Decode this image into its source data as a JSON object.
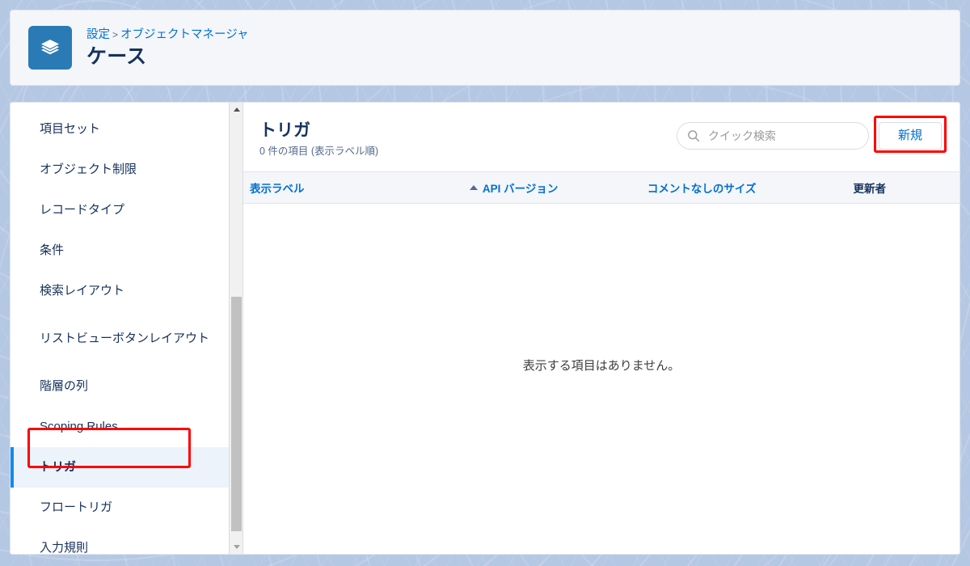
{
  "header": {
    "object_icon": "stacked-layers-icon",
    "breadcrumb": {
      "root": "設定",
      "separator": ">",
      "section": "オブジェクトマネージャ"
    },
    "page_title": "ケース"
  },
  "sidebar": {
    "items": [
      {
        "label": "項目セット",
        "selected": false
      },
      {
        "label": "オブジェクト制限",
        "selected": false
      },
      {
        "label": "レコードタイプ",
        "selected": false
      },
      {
        "label": "条件",
        "selected": false
      },
      {
        "label": "検索レイアウト",
        "selected": false
      },
      {
        "label": "リストビューボタンレイアウト",
        "selected": false,
        "two_line": true
      },
      {
        "label": "階層の列",
        "selected": false
      },
      {
        "label": "Scoping Rules",
        "selected": false
      },
      {
        "label": "トリガ",
        "selected": true
      },
      {
        "label": "フロートリガ",
        "selected": false
      },
      {
        "label": "入力規則",
        "selected": false
      }
    ]
  },
  "main": {
    "list_title": "トリガ",
    "list_subtitle": "0 件の項目 (表示ラベル順)",
    "search": {
      "placeholder": "クイック検索",
      "value": "",
      "icon": "search-icon"
    },
    "new_button": "新規",
    "table": {
      "columns": [
        {
          "label": "表示ラベル",
          "sortable": true,
          "sorted": "asc"
        },
        {
          "label": "API バージョン",
          "sortable": true,
          "sorted": "none"
        },
        {
          "label": "コメントなしのサイズ",
          "sortable": true,
          "sorted": "none"
        },
        {
          "label": "更新者",
          "sortable": false,
          "sorted": "none"
        }
      ],
      "rows": [],
      "empty_message": "表示する項目はありません。"
    }
  },
  "colors": {
    "brand_blue": "#0070d2",
    "icon_blue": "#2a7bb5",
    "selected_bg": "#ecf3fb",
    "selected_accent": "#1589ee",
    "annotation_red": "#ff0000",
    "page_bg": "#b5c8e3",
    "header_card_bg": "#f4f6f9",
    "text_dark": "#16325c"
  }
}
